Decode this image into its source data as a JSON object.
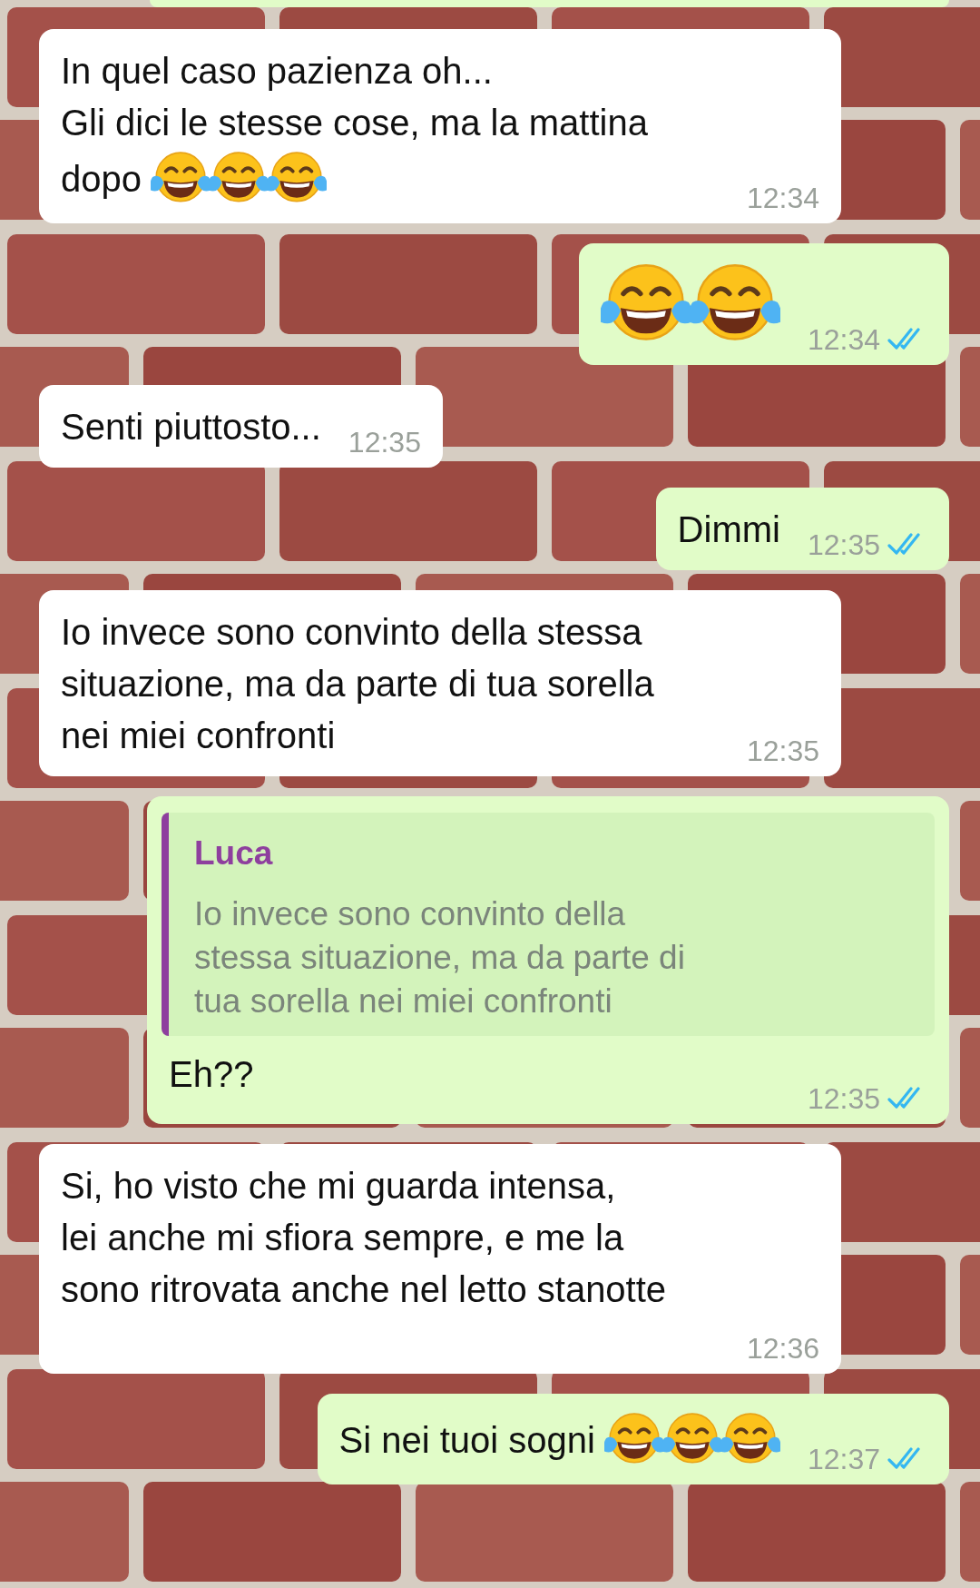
{
  "cut_off_bubble": {
    "kind": "sent"
  },
  "messages": [
    {
      "kind": "received",
      "text": "In quel caso pazienza oh...\nGli dici le stesse cose, ma la mattina\ndopo",
      "emoji": [
        {
          "kind": "tears-of-joy"
        },
        {
          "kind": "tears-of-joy"
        },
        {
          "kind": "tears-of-joy"
        }
      ],
      "time": "12:34"
    },
    {
      "kind": "sent",
      "emoji": [
        {
          "kind": "tears-of-joy"
        },
        {
          "kind": "tears-of-joy"
        }
      ],
      "time": "12:34",
      "read": true
    },
    {
      "kind": "received",
      "text": "Senti piuttosto...",
      "time": "12:35"
    },
    {
      "kind": "sent",
      "text": "Dimmi",
      "time": "12:35",
      "read": true
    },
    {
      "kind": "received",
      "text": "Io invece sono convinto della stessa\nsituazione, ma da parte di tua sorella\nnei miei confronti",
      "time": "12:35"
    },
    {
      "kind": "sent",
      "quote": {
        "author": "Luca",
        "text": "Io invece sono convinto della\nstessa situazione, ma da parte di\ntua sorella nei miei confronti"
      },
      "text": "Eh??",
      "time": "12:35",
      "read": true
    },
    {
      "kind": "received",
      "text": "Si, ho visto che mi guarda intensa,\nlei anche mi sfiora sempre, e me la\nsono ritrovata anche nel letto stanotte",
      "time": "12:36",
      "time_on_own_line": true
    },
    {
      "kind": "sent",
      "text": "Si nei tuoi sogni",
      "emoji": [
        {
          "kind": "tears-of-joy"
        },
        {
          "kind": "tears-of-joy"
        },
        {
          "kind": "tears-of-joy"
        }
      ],
      "time": "12:37",
      "read": true
    }
  ]
}
